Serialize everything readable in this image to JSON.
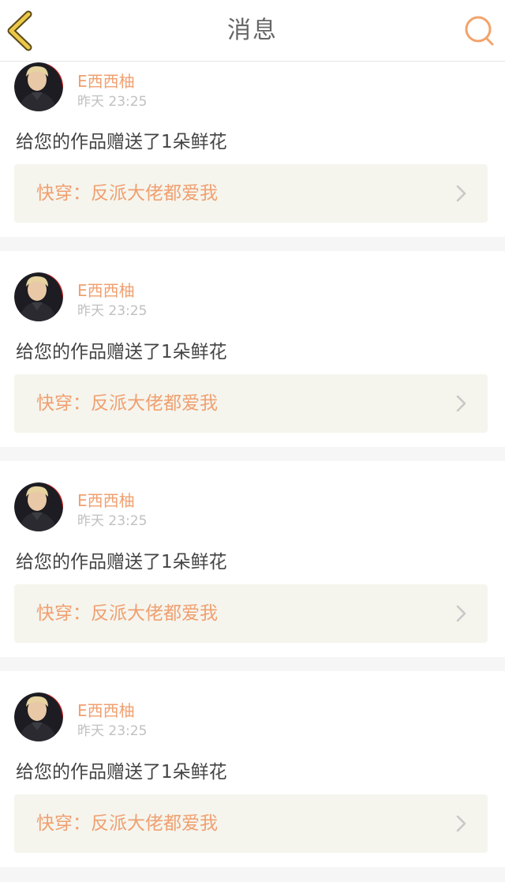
{
  "header": {
    "title": "消息",
    "back_icon": "chevron-left-icon",
    "search_icon": "search-icon",
    "accent_color": "#f2a36a",
    "back_color": "#e8c340"
  },
  "messages": [
    {
      "username": "E西西柚",
      "time": "昨天  23:25",
      "text": "给您的作品赠送了1朵鲜花",
      "book_title": "快穿：反派大佬都爱我"
    },
    {
      "username": "E西西柚",
      "time": "昨天  23:25",
      "text": "给您的作品赠送了1朵鲜花",
      "book_title": "快穿：反派大佬都爱我"
    },
    {
      "username": "E西西柚",
      "time": "昨天  23:25",
      "text": "给您的作品赠送了1朵鲜花",
      "book_title": "快穿：反派大佬都爱我"
    },
    {
      "username": "E西西柚",
      "time": "昨天  23:25",
      "text": "给您的作品赠送了1朵鲜花",
      "book_title": "快穿：反派大佬都爱我"
    }
  ]
}
